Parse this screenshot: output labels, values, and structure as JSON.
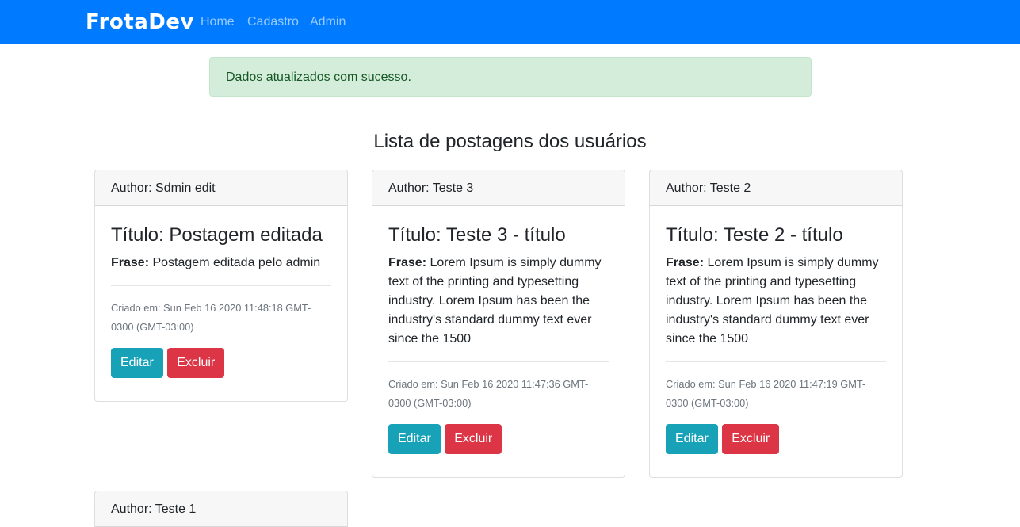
{
  "navbar": {
    "brand": "FrotaDev",
    "links": [
      "Home",
      "Cadastro",
      "Admin"
    ]
  },
  "alert": {
    "message": "Dados atualizados com sucesso."
  },
  "page": {
    "title": "Lista de postagens dos usuários"
  },
  "labels": {
    "phrase_label": "Frase:",
    "edit_button": "Editar",
    "delete_button": "Excluir"
  },
  "posts": [
    {
      "author": "Author: Sdmin edit",
      "title": "Título: Postagem editada",
      "phrase": "Postagem editada pelo admin",
      "created": "Criado em: Sun Feb 16 2020 11:48:18 GMT-0300 (GMT-03:00)"
    },
    {
      "author": "Author: Teste 3",
      "title": "Título: Teste 3 - título",
      "phrase": "Lorem Ipsum is simply dummy text of the printing and typesetting industry. Lorem Ipsum has been the industry's standard dummy text ever since the 1500",
      "created": "Criado em: Sun Feb 16 2020 11:47:36 GMT-0300 (GMT-03:00)"
    },
    {
      "author": "Author: Teste 2",
      "title": "Título: Teste 2 - título",
      "phrase": "Lorem Ipsum is simply dummy text of the printing and typesetting industry. Lorem Ipsum has been the industry's standard dummy text ever since the 1500",
      "created": "Criado em: Sun Feb 16 2020 11:47:19 GMT-0300 (GMT-03:00)"
    },
    {
      "author": "Author: Teste 1"
    }
  ]
}
